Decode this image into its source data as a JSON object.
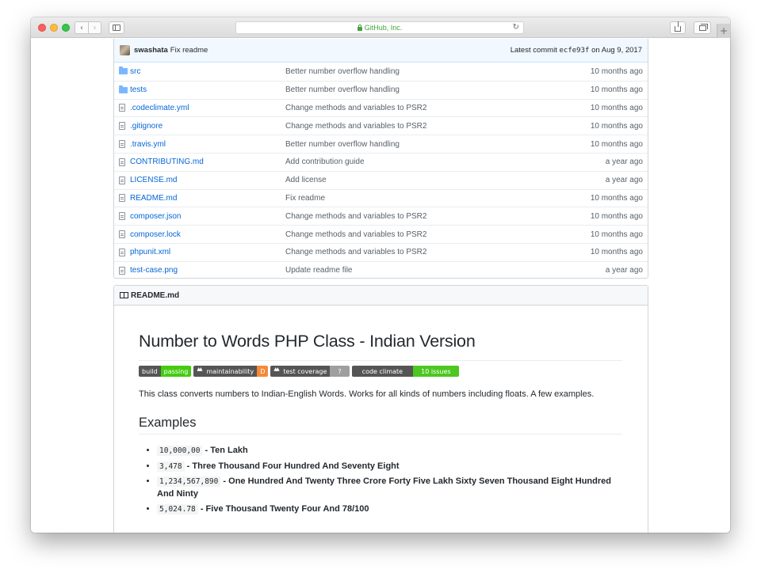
{
  "browser": {
    "address": "GitHub, Inc."
  },
  "colors": {
    "link": "#0366d6",
    "muted": "#586069",
    "commit_bar_bg": "#f1f8ff",
    "secure_green": "#3fa43a"
  },
  "commit": {
    "author": "swashata",
    "message": "Fix readme",
    "latest_label": "Latest commit",
    "sha": "ecfe93f",
    "date": "on Aug 9, 2017"
  },
  "files": [
    {
      "name": "src",
      "icon": "folder-icon",
      "message": "Better number overflow handling",
      "age": "10 months ago"
    },
    {
      "name": "tests",
      "icon": "folder-icon",
      "message": "Better number overflow handling",
      "age": "10 months ago"
    },
    {
      "name": ".codeclimate.yml",
      "icon": "file-icon",
      "message": "Change methods and variables to PSR2",
      "age": "10 months ago"
    },
    {
      "name": ".gitignore",
      "icon": "file-icon",
      "message": "Change methods and variables to PSR2",
      "age": "10 months ago"
    },
    {
      "name": ".travis.yml",
      "icon": "file-icon",
      "message": "Better number overflow handling",
      "age": "10 months ago"
    },
    {
      "name": "CONTRIBUTING.md",
      "icon": "file-icon",
      "message": "Add contribution guide",
      "age": "a year ago"
    },
    {
      "name": "LICENSE.md",
      "icon": "file-icon",
      "message": "Add license",
      "age": "a year ago"
    },
    {
      "name": "README.md",
      "icon": "file-icon",
      "message": "Fix readme",
      "age": "10 months ago"
    },
    {
      "name": "composer.json",
      "icon": "file-icon",
      "message": "Change methods and variables to PSR2",
      "age": "10 months ago"
    },
    {
      "name": "composer.lock",
      "icon": "file-icon",
      "message": "Change methods and variables to PSR2",
      "age": "10 months ago"
    },
    {
      "name": "phpunit.xml",
      "icon": "file-icon",
      "message": "Change methods and variables to PSR2",
      "age": "10 months ago"
    },
    {
      "name": "test-case.png",
      "icon": "file-icon",
      "message": "Update readme file",
      "age": "a year ago"
    }
  ],
  "readme": {
    "header": "README.md",
    "title": "Number to Words PHP Class - Indian Version",
    "badges": {
      "build_left": "build",
      "build_right": "passing",
      "maint_left": "maintainability",
      "maint_right": "D",
      "cov_left": "test coverage",
      "cov_right": "?",
      "cc_left": "code climate",
      "cc_right": "10 issues"
    },
    "intro": "This class converts numbers to Indian-English Words. Works for all kinds of numbers including floats. A few examples.",
    "examples_heading": "Examples",
    "examples": [
      {
        "number": "10,000,00",
        "words": "- Ten Lakh"
      },
      {
        "number": "3,478",
        "words": "- Three Thousand Four Hundred And Seventy Eight"
      },
      {
        "number": "1,234,567,890",
        "words": "- One Hundred And Twenty Three Crore Forty Five Lakh Sixty Seven Thousand Eight Hundred And Ninty"
      },
      {
        "number": "5,024.78",
        "words": "- Five Thousand Twenty Four And 78/100"
      }
    ]
  }
}
